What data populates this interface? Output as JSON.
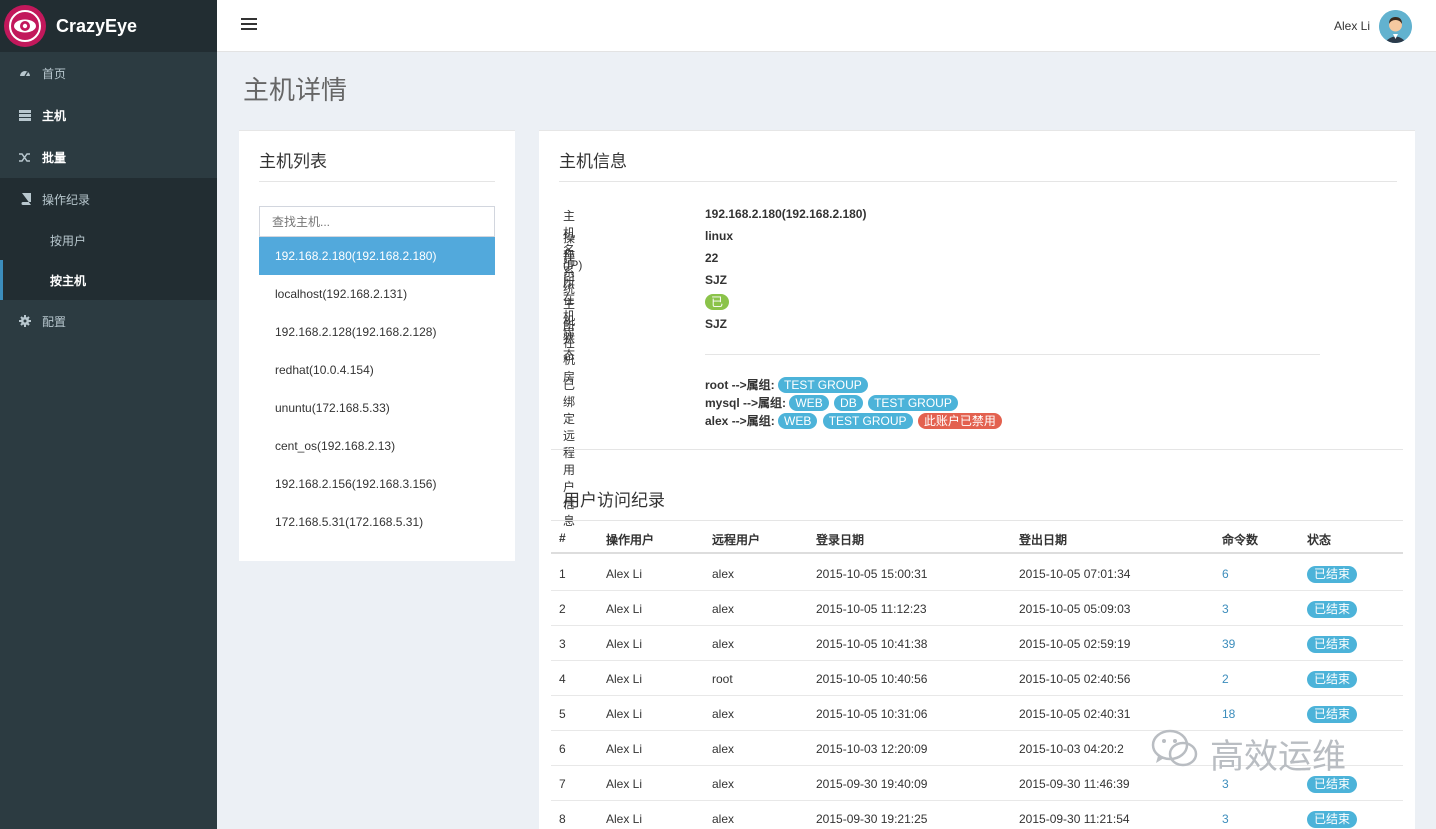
{
  "app": {
    "name": "CrazyEye"
  },
  "sidebar": {
    "items": [
      {
        "label": "首页",
        "icon": "dashboard-icon"
      },
      {
        "label": "主机",
        "icon": "server-icon"
      },
      {
        "label": "批量",
        "icon": "shuffle-icon"
      },
      {
        "label": "操作纪录",
        "icon": "book-icon"
      },
      {
        "label": "按用户"
      },
      {
        "label": "按主机"
      },
      {
        "label": "配置",
        "icon": "gear-icon"
      }
    ]
  },
  "header": {
    "user_name": "Alex Li"
  },
  "page": {
    "title": "主机详情"
  },
  "host_list": {
    "title": "主机列表",
    "search_placeholder": "查找主机...",
    "hosts": [
      "192.168.2.180(192.168.2.180)",
      "localhost(192.168.2.131)",
      "192.168.2.128(192.168.2.128)",
      "redhat(10.0.4.154)",
      "ununtu(172.168.5.33)",
      "cent_os(192.168.2.13)",
      "192.168.2.156(192.168.3.156)",
      "172.168.5.31(172.168.5.31)"
    ]
  },
  "host_info": {
    "title": "主机信息",
    "rows": [
      {
        "label": "主机名(IP)",
        "value": "192.168.2.180(192.168.2.180)"
      },
      {
        "label": "操作系统",
        "value": "linux"
      },
      {
        "label": "端口",
        "value": "22"
      },
      {
        "label": "所在机房",
        "value": "SJZ"
      },
      {
        "label": "主机状态",
        "value": "已启用"
      },
      {
        "label": "所在机房",
        "value": "SJZ"
      }
    ],
    "bound_label": "已绑定远程用户信息",
    "bound_users": [
      {
        "user": "root -->属组:",
        "groups": [
          "TEST GROUP"
        ]
      },
      {
        "user": "mysql -->属组:",
        "groups": [
          "WEB",
          "DB",
          "TEST GROUP"
        ]
      },
      {
        "user": "alex -->属组:",
        "groups": [
          "WEB",
          "TEST GROUP"
        ],
        "disabled": "此账户已禁用"
      }
    ]
  },
  "access_log": {
    "title": "用户访问纪录",
    "columns": [
      "#",
      "操作用户",
      "远程用户",
      "登录日期",
      "登出日期",
      "命令数",
      "状态"
    ],
    "rows": [
      [
        "1",
        "Alex Li",
        "alex",
        "2015-10-05 15:00:31",
        "2015-10-05 07:01:34",
        "6",
        "已结束"
      ],
      [
        "2",
        "Alex Li",
        "alex",
        "2015-10-05 11:12:23",
        "2015-10-05 05:09:03",
        "3",
        "已结束"
      ],
      [
        "3",
        "Alex Li",
        "alex",
        "2015-10-05 10:41:38",
        "2015-10-05 02:59:19",
        "39",
        "已结束"
      ],
      [
        "4",
        "Alex Li",
        "root",
        "2015-10-05 10:40:56",
        "2015-10-05 02:40:56",
        "2",
        "已结束"
      ],
      [
        "5",
        "Alex Li",
        "alex",
        "2015-10-05 10:31:06",
        "2015-10-05 02:40:31",
        "18",
        "已结束"
      ],
      [
        "6",
        "Alex Li",
        "alex",
        "2015-10-03 12:20:09",
        "2015-10-03 04:20:2",
        "",
        ""
      ],
      [
        "7",
        "Alex Li",
        "alex",
        "2015-09-30 19:40:09",
        "2015-09-30 11:46:39",
        "3",
        "已结束"
      ],
      [
        "8",
        "Alex Li",
        "alex",
        "2015-09-30 19:21:25",
        "2015-09-30 11:21:54",
        "3",
        "已结束"
      ]
    ]
  },
  "watermark": {
    "text": "高效运维"
  },
  "colors": {
    "sidebar_bg": "#2c3b41",
    "logo_bg": "#222d32",
    "active_host": "#52a9dc",
    "badge_blue": "#4cb3d9",
    "badge_green": "#8bc34a",
    "badge_red": "#e3614f",
    "link": "#3c8dbc"
  }
}
